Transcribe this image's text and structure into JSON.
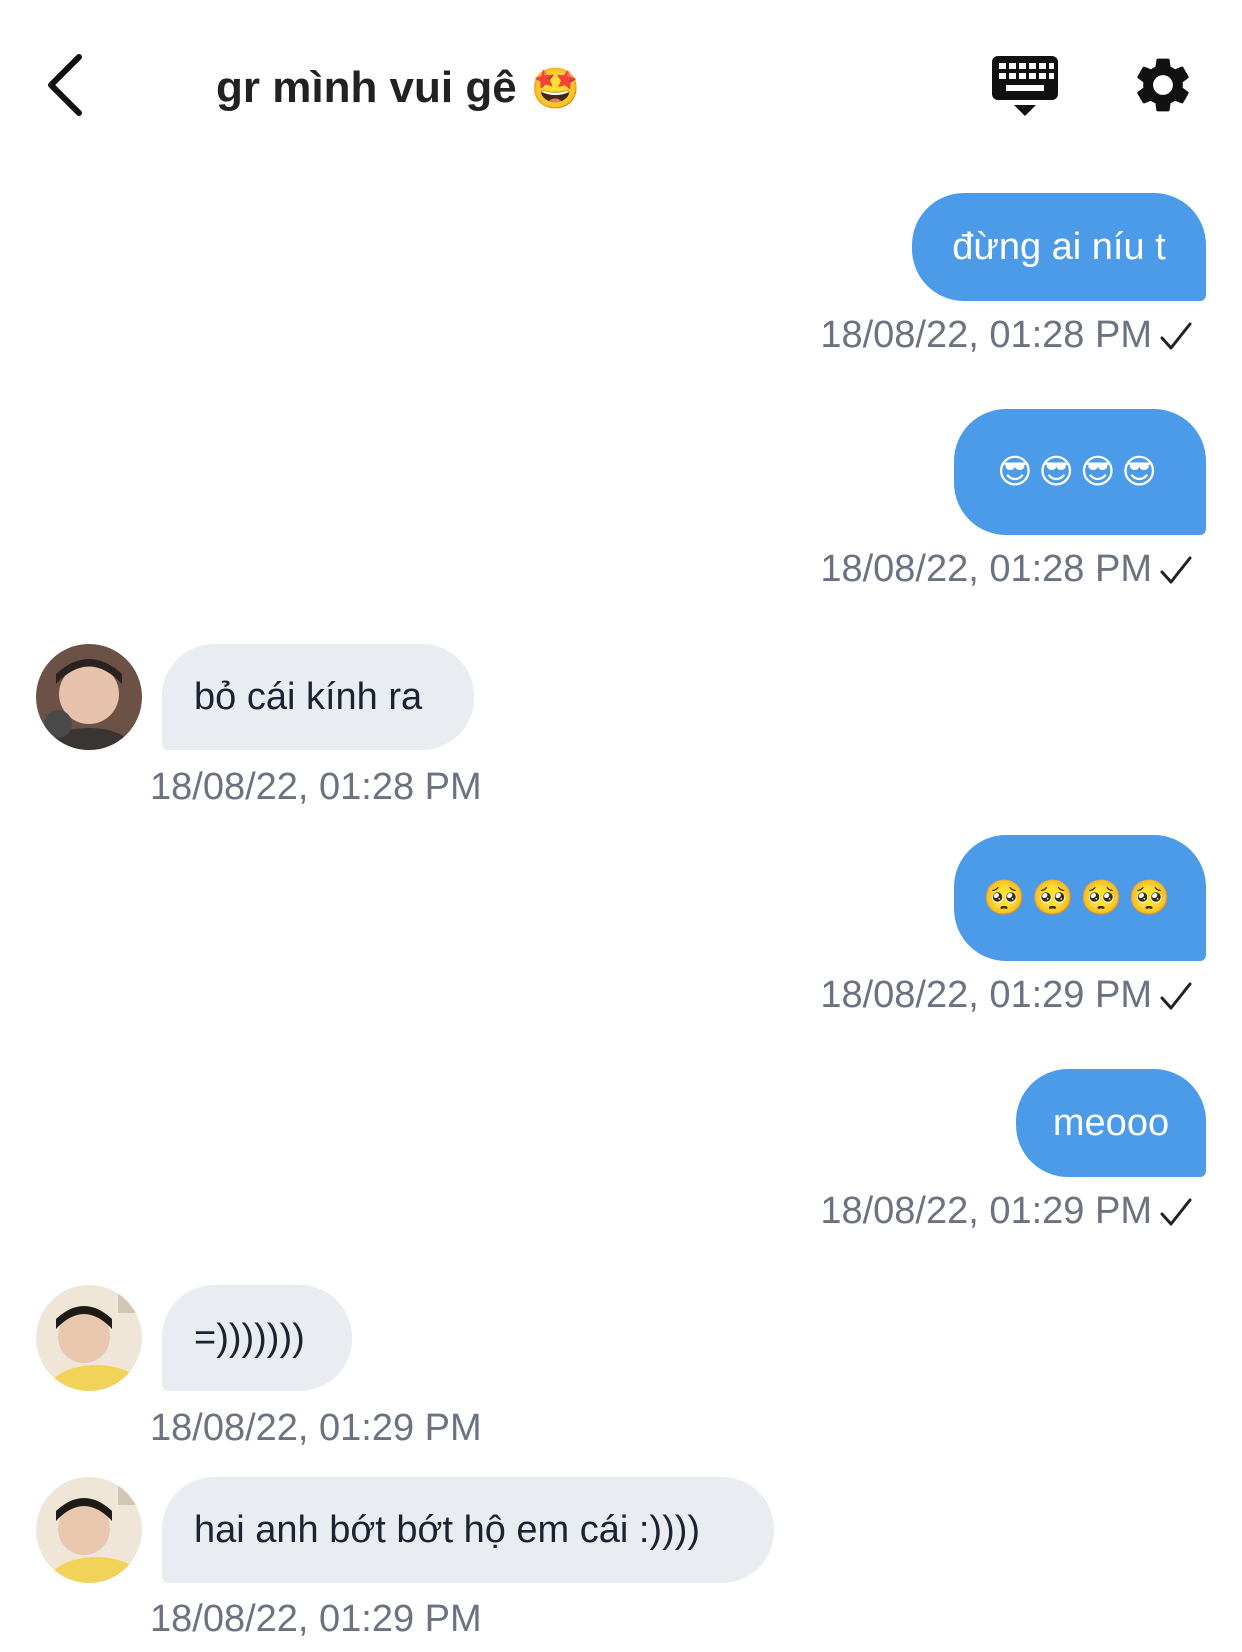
{
  "header": {
    "title": "gr mình vui gê",
    "title_emoji": "🤩",
    "back_icon": "chevron-left-icon",
    "keyboard_icon": "keyboard-icon",
    "settings_icon": "gear-icon"
  },
  "colors": {
    "outgoing_bubble": "#4c9be8",
    "incoming_bubble": "#e9ecf0",
    "timestamp": "#6b7280"
  },
  "messages": [
    {
      "direction": "out",
      "text": "đừng ai níu t",
      "time": "18/08/22, 01:28 PM",
      "status": "sent-check-icon"
    },
    {
      "direction": "out",
      "text": "😎😎😎😎",
      "time": "18/08/22, 01:28 PM",
      "status": "sent-check-icon"
    },
    {
      "direction": "in",
      "text": "bỏ cái kính ra",
      "time": "18/08/22, 01:28 PM",
      "avatar": "avatar-user-1"
    },
    {
      "direction": "out",
      "text": "🥺🥺🥺🥺",
      "time": "18/08/22, 01:29 PM",
      "status": "sent-check-icon"
    },
    {
      "direction": "out",
      "text": "meooo",
      "time": "18/08/22, 01:29 PM",
      "status": "sent-check-icon"
    },
    {
      "direction": "in",
      "text": "=)))))))",
      "time": "18/08/22, 01:29 PM",
      "avatar": "avatar-user-2"
    },
    {
      "direction": "in",
      "text": "hai anh bớt bớt hộ em cái :))))",
      "time": "18/08/22, 01:29 PM",
      "avatar": "avatar-user-2"
    }
  ]
}
